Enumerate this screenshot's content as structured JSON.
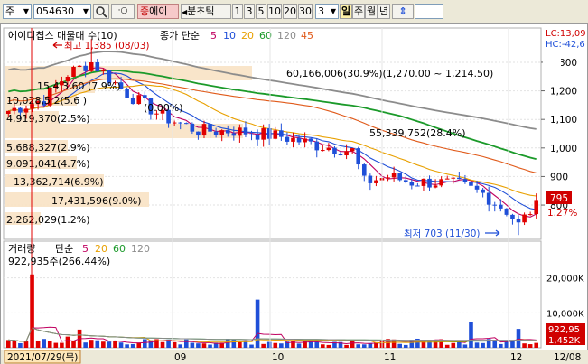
{
  "toolbar": {
    "market_select": "주",
    "code_input": "054630",
    "search_icon": "magnifier-icon",
    "name_badge": "증",
    "name_text": "에이",
    "period_arrow": "◀",
    "period_label": "분초틱",
    "period_buttons": [
      "1",
      "3",
      "5",
      "10",
      "20",
      "30"
    ],
    "period_value": "3",
    "unit_selected": "일",
    "unit_buttons": [
      "주",
      "월",
      "년"
    ],
    "updown_icon": "up-down-arrow-icon"
  },
  "price_panel": {
    "title": "에이디칩스 매물대 수(10)",
    "legend_label": "종가 단순",
    "ma_periods": [
      "5",
      "10",
      "20",
      "60",
      "120",
      "45"
    ],
    "ma_colors": [
      "#c00060",
      "#1f4fd8",
      "#e8a000",
      "#1b9a2a",
      "#8c8c8c",
      "#e05a1a"
    ],
    "lc_text": "LC:13,09",
    "hc_text": "HC:-42,6",
    "y_ticks": [
      "1,300",
      "1,200",
      "1,100",
      "1,000",
      "900",
      "800"
    ],
    "high_label": "최고 1,385 (08/03)",
    "low_label": "최저 703 (11/30)",
    "current_price": "795",
    "current_change": "1.27%",
    "volume_profile": [
      {
        "label": "60,166,006(30.9%)(1,270.00 ~ 1,214.50)",
        "share": 30.9
      },
      {
        "label": "15,4 3,60 (7.9%)",
        "share": 7.9
      },
      {
        "label": "10,028,5 2(5.6 )",
        "share": 5.6
      },
      {
        "label": "(0.00%)",
        "share": 0.0
      },
      {
        "label": "4,919,370(2.5%)",
        "share": 2.5
      },
      {
        "label": "55,339,752(28.4%)",
        "share": 28.4
      },
      {
        "label": "5,688,327(2.9%)",
        "share": 2.9
      },
      {
        "label": "9,091,041(4.7%)",
        "share": 4.7
      },
      {
        "label": "13,362,714(6.9%)",
        "share": 6.9
      },
      {
        "label": "17,431,596(9.0%)",
        "share": 9.0
      },
      {
        "label": "2,262,029(1.2%)",
        "share": 1.2
      }
    ]
  },
  "volume_panel": {
    "title": "거래량",
    "legend_label": "단순",
    "ma_periods": [
      "5",
      "20",
      "60",
      "120"
    ],
    "ma_colors": [
      "#c00060",
      "#e8a000",
      "#1b9a2a",
      "#8c8c8c"
    ],
    "peak_label": "922,935주(266.44%)",
    "y_ticks": [
      "20,000K",
      "10,000K"
    ],
    "last_volume": "922,95",
    "last_volume_k": "1,452K"
  },
  "x_axis": {
    "cursor_date": "2021/07/29(목)",
    "month_ticks": [
      "09",
      "10",
      "11",
      "12"
    ],
    "right_label": "12/08"
  }
}
